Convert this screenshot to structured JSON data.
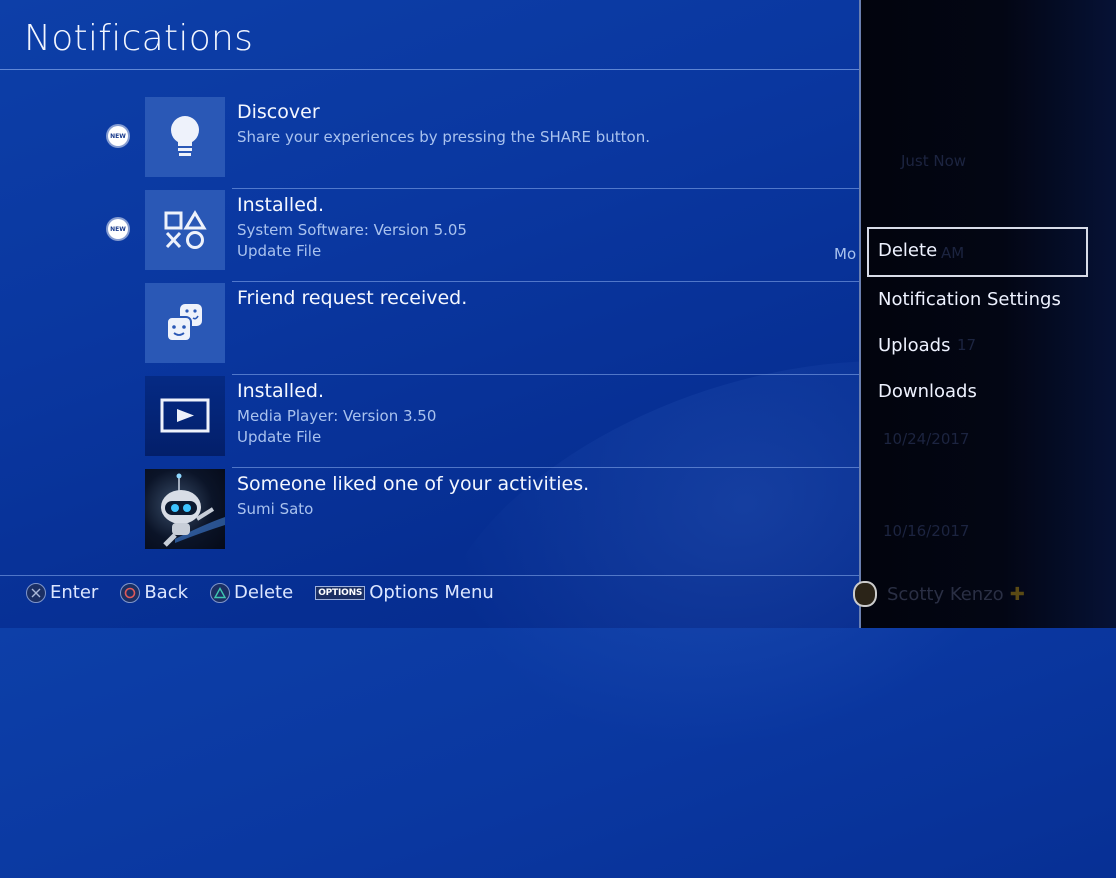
{
  "header": {
    "title": "Notifications"
  },
  "notifications": [
    {
      "icon": "lightbulb-icon",
      "is_new": true,
      "new_label": "NEW",
      "headline": "Discover",
      "line1": "Share your experiences by pressing the SHARE button.",
      "line2": ""
    },
    {
      "icon": "playstation-shapes-icon",
      "is_new": true,
      "new_label": "NEW",
      "headline": "Installed.",
      "line1": "System Software: Version 5.05",
      "line2": "Update File",
      "trailing": "Mo"
    },
    {
      "icon": "friends-icon",
      "is_new": false,
      "headline": "Friend request received.",
      "line1": "",
      "line2": ""
    },
    {
      "icon": "media-player-icon",
      "is_new": false,
      "headline": "Installed.",
      "line1": "Media Player: Version 3.50",
      "line2": "Update File"
    },
    {
      "icon": "astro-bot-avatar",
      "is_new": false,
      "headline": "Someone liked one of your activities.",
      "line1": "Sumi Sato",
      "line2": ""
    }
  ],
  "footer_hints": [
    {
      "button": "cross",
      "label": "Enter"
    },
    {
      "button": "circle",
      "label": "Back"
    },
    {
      "button": "triangle",
      "label": "Delete"
    },
    {
      "button": "options",
      "button_label": "OPTIONS",
      "label": "Options Menu"
    }
  ],
  "options_menu": {
    "items": [
      {
        "label": "Delete",
        "focused": true
      },
      {
        "label": "Notification Settings",
        "focused": false
      },
      {
        "label": "Uploads",
        "focused": false
      },
      {
        "label": "Downloads",
        "focused": false
      }
    ]
  },
  "background_panel": {
    "timestamps": [
      "Just Now",
      "AM",
      "17",
      "10/24/2017",
      "10/16/2017"
    ],
    "user_name": "Scotty Kenzo"
  }
}
